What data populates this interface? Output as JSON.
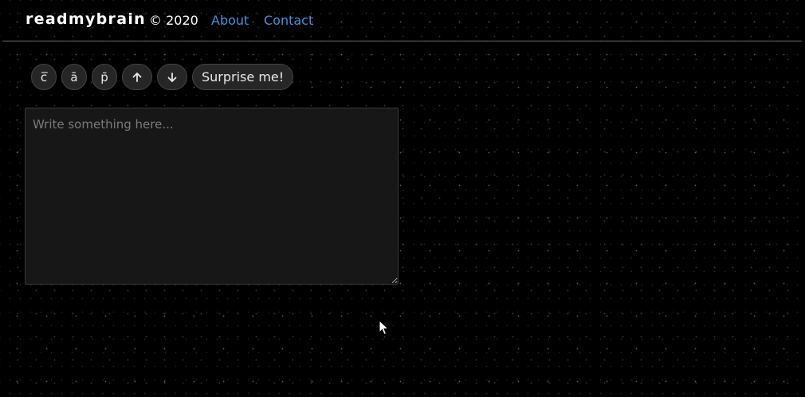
{
  "header": {
    "brand": "readmybrain",
    "copyright": "© 2020",
    "nav": [
      {
        "label": "About"
      },
      {
        "label": "Contact"
      }
    ]
  },
  "toolbar": {
    "buttons": [
      {
        "label": "c̅",
        "icon": "c-macron"
      },
      {
        "label": "ā",
        "icon": "a-macron"
      },
      {
        "label": "p̄",
        "icon": "p-macron"
      },
      {
        "icon": "arrow-up-icon"
      },
      {
        "icon": "arrow-down-icon"
      },
      {
        "label": "Surprise me!"
      }
    ]
  },
  "editor": {
    "placeholder": "Write something here...",
    "value": ""
  },
  "colors": {
    "background": "#000000",
    "link": "#4a90d9",
    "button_bg": "#262626",
    "editor_bg": "#171717",
    "divider": "#6e6e6e"
  }
}
